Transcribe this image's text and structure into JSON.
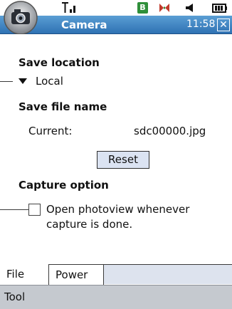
{
  "status_bar": {
    "signal_icon": "signal-strength-icon",
    "bluetooth_badge": "B",
    "message_icon": "message-icon",
    "volume_icon": "speaker-icon",
    "battery_icon": "battery-icon"
  },
  "title_bar": {
    "title": "Camera",
    "time": "11:58",
    "close_label": "✕"
  },
  "sections": {
    "save_location": {
      "title": "Save location",
      "selected": "Local"
    },
    "save_file_name": {
      "title": "Save file name",
      "current_label": "Current:",
      "current_value": "sdc00000.jpg",
      "reset_label": "Reset"
    },
    "capture_option": {
      "title": "Capture option",
      "checkbox_label": "Open photoview whenever capture is done.",
      "checked": false
    }
  },
  "tabs": [
    {
      "label": "File",
      "active": true
    },
    {
      "label": "Power",
      "active": false
    }
  ],
  "toolbar": {
    "tool_label": "Tool"
  },
  "colors": {
    "title_bar": "#2f72b3",
    "toolbar": "#c5c9cf",
    "button": "#dbe3f2"
  }
}
